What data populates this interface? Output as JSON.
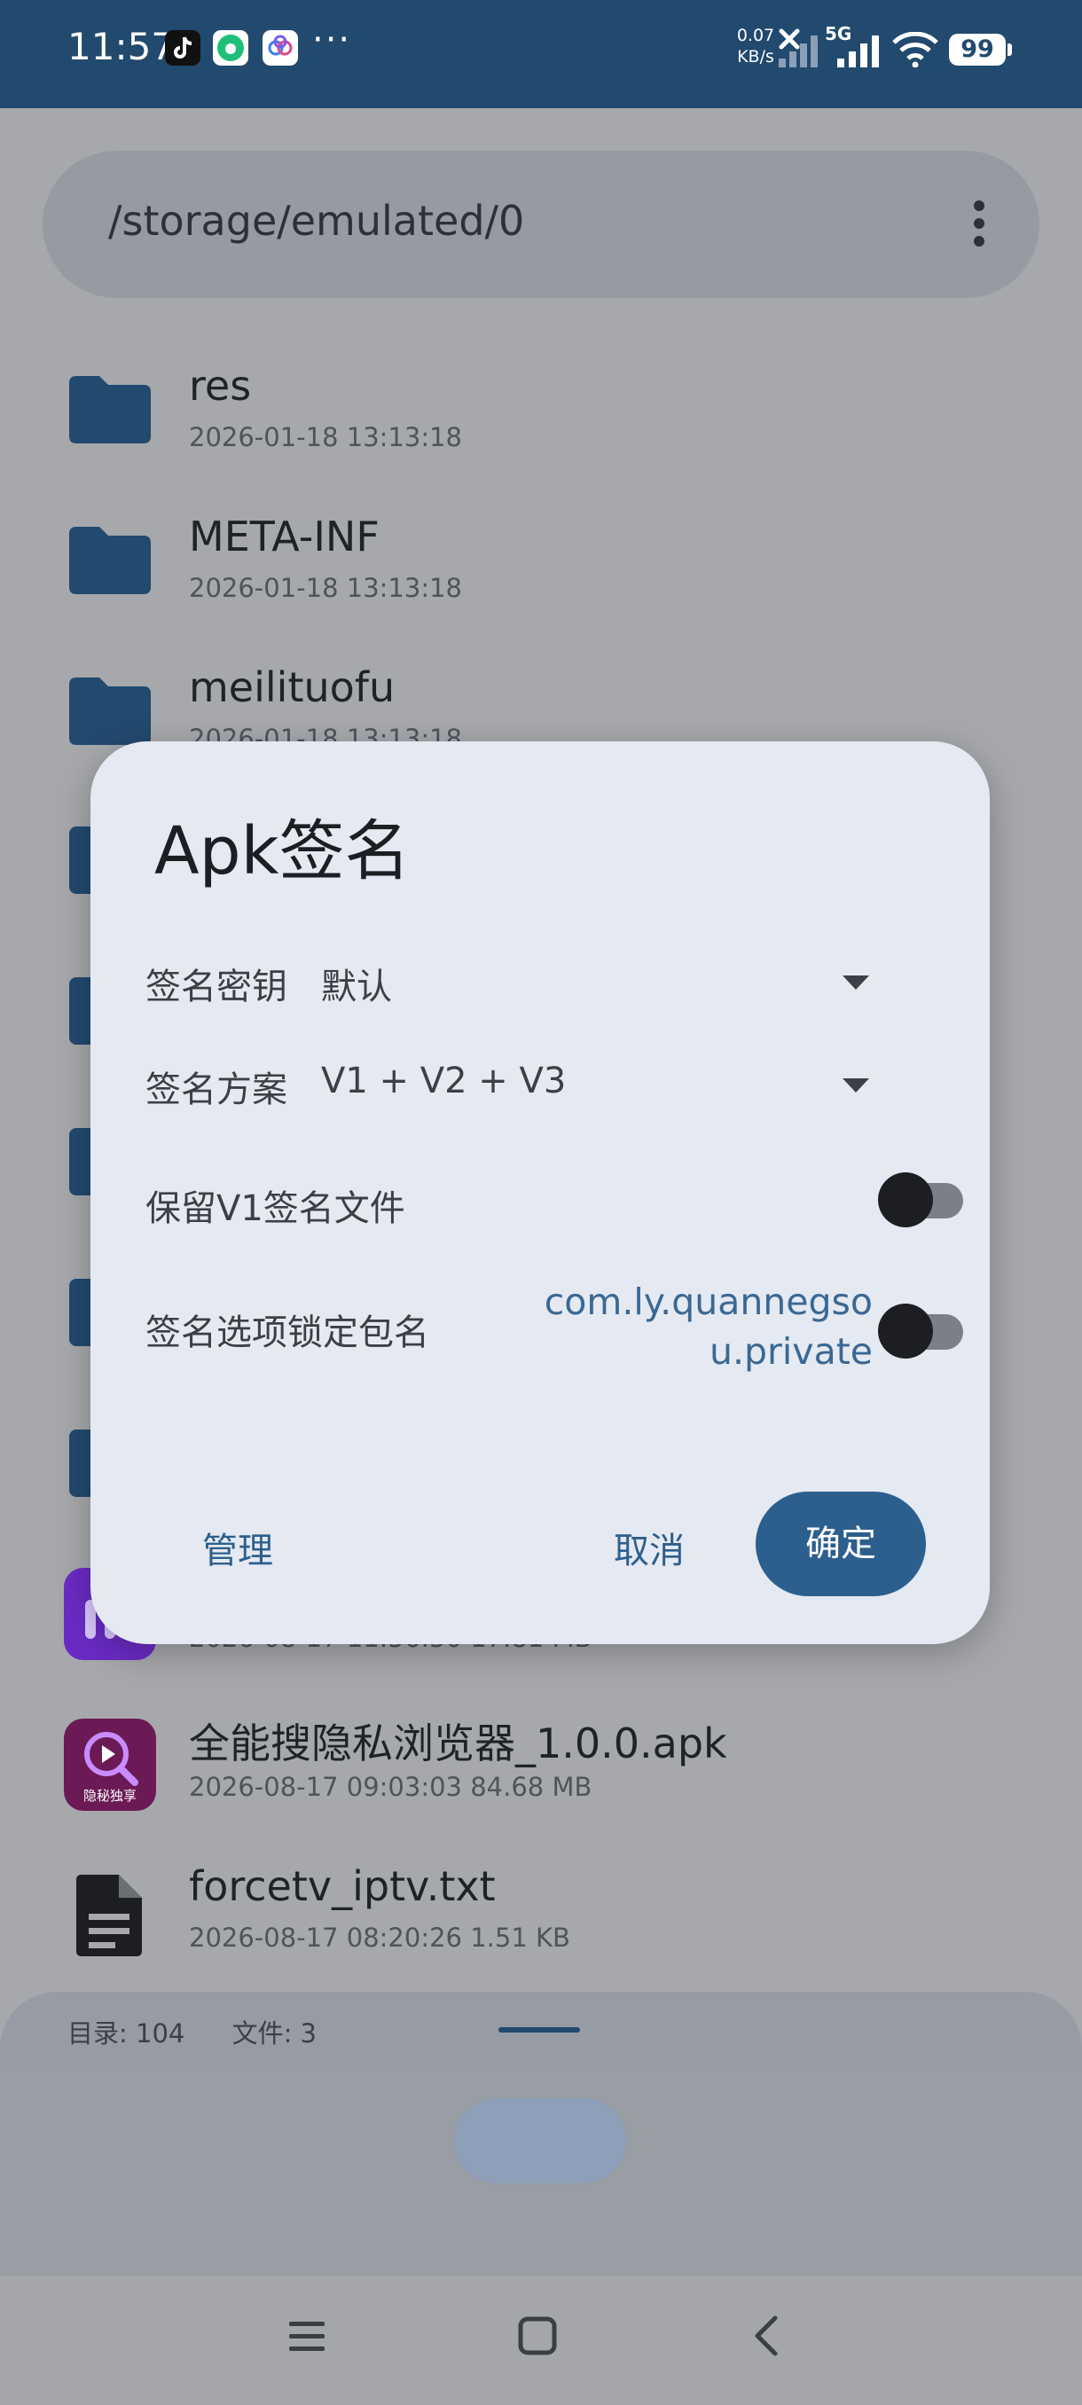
{
  "status_bar": {
    "time": "11:57",
    "more": "···",
    "net_speed_value": "0.07",
    "net_speed_unit": "KB/s",
    "network_type": "5G",
    "battery": "99",
    "icons": [
      "tiktok-app-icon",
      "green-app-icon",
      "cloud-app-icon",
      "mute-icon",
      "signal-icon",
      "wifi-icon",
      "battery-icon"
    ]
  },
  "path_bar": {
    "path": "/storage/emulated/0"
  },
  "files": [
    {
      "name": "res",
      "meta": "2026-01-18 13:13:18",
      "type": "folder"
    },
    {
      "name": "META-INF",
      "meta": "2026-01-18 13:13:18",
      "type": "folder"
    },
    {
      "name": "meilituofu",
      "meta": "2026-01-18 13:13:18",
      "type": "folder"
    },
    {
      "name": "",
      "meta": "2026-08-17 11:56:50   17.81 MB",
      "type": "apk"
    },
    {
      "name": "全能搜隐私浏览器_1.0.0.apk",
      "meta": "2026-08-17 09:03:03   84.68 MB",
      "type": "apk",
      "icon_label": "隐秘独享"
    },
    {
      "name": "forcetv_iptv.txt",
      "meta": "2026-08-17 08:20:26   1.51 KB",
      "type": "text"
    }
  ],
  "bottom": {
    "dirs": "目录: 104",
    "files": "文件: 3"
  },
  "dialog": {
    "title": "Apk签名",
    "key_label": "签名密钥",
    "key_value": "默认",
    "scheme_label": "签名方案",
    "scheme_value": "V1 + V2 + V3",
    "keep_v1_label": "保留V1签名文件",
    "keep_v1_on": false,
    "lock_pkg_label": "签名选项锁定包名",
    "lock_pkg_value": "com.ly.quannegsou.private",
    "lock_pkg_on": false,
    "manage_button": "管理",
    "cancel_button": "取消",
    "ok_button": "确定"
  },
  "colors": {
    "primary": "#2d5f8e",
    "status_bar": "#22496e",
    "dialog_bg": "#e5e9f1",
    "scrim_bg": "#a6a8ac"
  }
}
